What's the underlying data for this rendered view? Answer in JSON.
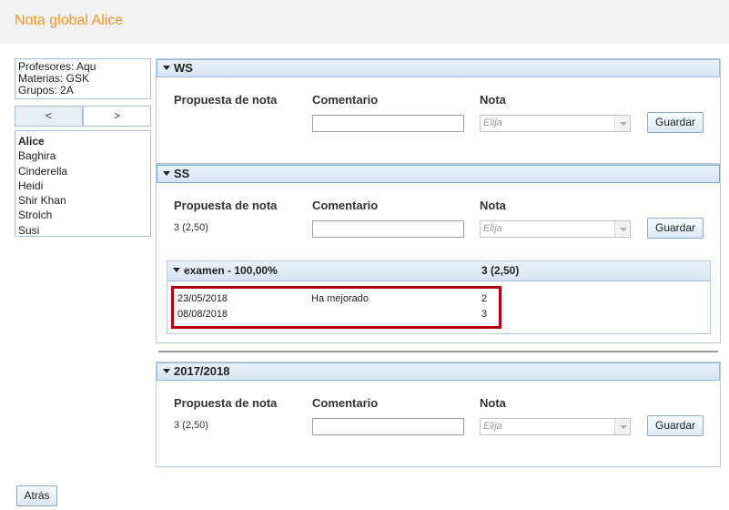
{
  "page_title": "Nota global Alice",
  "info": {
    "profesores": "Profesores: Aqu",
    "materias": "Materias: GSK",
    "grupos": "Grupos: 2A"
  },
  "pager": {
    "prev": "<",
    "next": ">"
  },
  "students": [
    "Alice",
    "Baghira",
    "Cinderella",
    "Heidi",
    "Shir Khan",
    "Strolch",
    "Susi"
  ],
  "selected_student": "Alice",
  "columns": {
    "propuesta": "Propuesta de nota",
    "comentario": "Comentario",
    "nota": "Nota"
  },
  "select_placeholder": "Elija",
  "save_label": "Guardar",
  "panels": [
    {
      "title": "WS",
      "proposal": ""
    },
    {
      "title": "SS",
      "proposal": "3 (2,50)",
      "subpanel": {
        "title": "examen - 100,00%",
        "score": "3 (2,50)",
        "rows": [
          {
            "date": "23/05/2018",
            "comment": "Ha mejorado",
            "grade": "2"
          },
          {
            "date": "08/08/2018",
            "comment": "",
            "grade": "3"
          }
        ]
      }
    },
    {
      "title": "2017/2018",
      "proposal": "3 (2,50)"
    }
  ],
  "back_label": "Atrás",
  "colors": {
    "title_orange": "#f7941d",
    "highlight_red": "#b00010",
    "header_blue": "#d6e4f3"
  }
}
